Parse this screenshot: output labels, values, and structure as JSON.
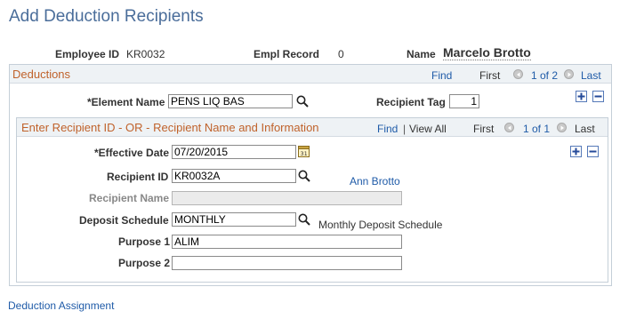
{
  "page": {
    "title": "Add Deduction Recipients"
  },
  "header": {
    "employee_id_label": "Employee ID",
    "employee_id": "KR0032",
    "empl_record_label": "Empl Record",
    "empl_record": "0",
    "name_label": "Name",
    "name": "Marcelo Brotto"
  },
  "deductions": {
    "title": "Deductions",
    "find": "Find",
    "first": "First",
    "page_range": "1 of 2",
    "last": "Last",
    "element_name_label": "*Element Name",
    "element_name": "PENS LIQ BAS",
    "recipient_tag_label": "Recipient Tag",
    "recipient_tag": "1"
  },
  "recipient": {
    "title": "Enter Recipient ID - OR - Recipient Name and Information",
    "find": "Find",
    "separator": "|",
    "view_all": "View All",
    "first": "First",
    "page_range": "1 of 1",
    "last": "Last",
    "effective_date_label": "*Effective Date",
    "effective_date": "07/20/2015",
    "recipient_id_label": "Recipient ID",
    "recipient_id": "KR0032A",
    "recipient_id_desc": "Ann Brotto",
    "recipient_name_label": "Recipient Name",
    "recipient_name": "",
    "deposit_schedule_label": "Deposit Schedule",
    "deposit_schedule": "MONTHLY",
    "deposit_schedule_desc": "Monthly Deposit Schedule",
    "purpose1_label": "Purpose 1",
    "purpose1": "ALIM",
    "purpose2_label": "Purpose 2",
    "purpose2": ""
  },
  "footer": {
    "link": "Deduction Assignment"
  },
  "icons": {
    "lookup": "magnifier-icon",
    "calendar": "calendar-icon",
    "prev": "previous-arrow-icon",
    "next": "next-arrow-icon",
    "add": "plus-icon",
    "remove": "minus-icon"
  },
  "colors": {
    "title": "#4a6d9a",
    "link": "#1f5ba8",
    "section_title": "#c0622b"
  }
}
